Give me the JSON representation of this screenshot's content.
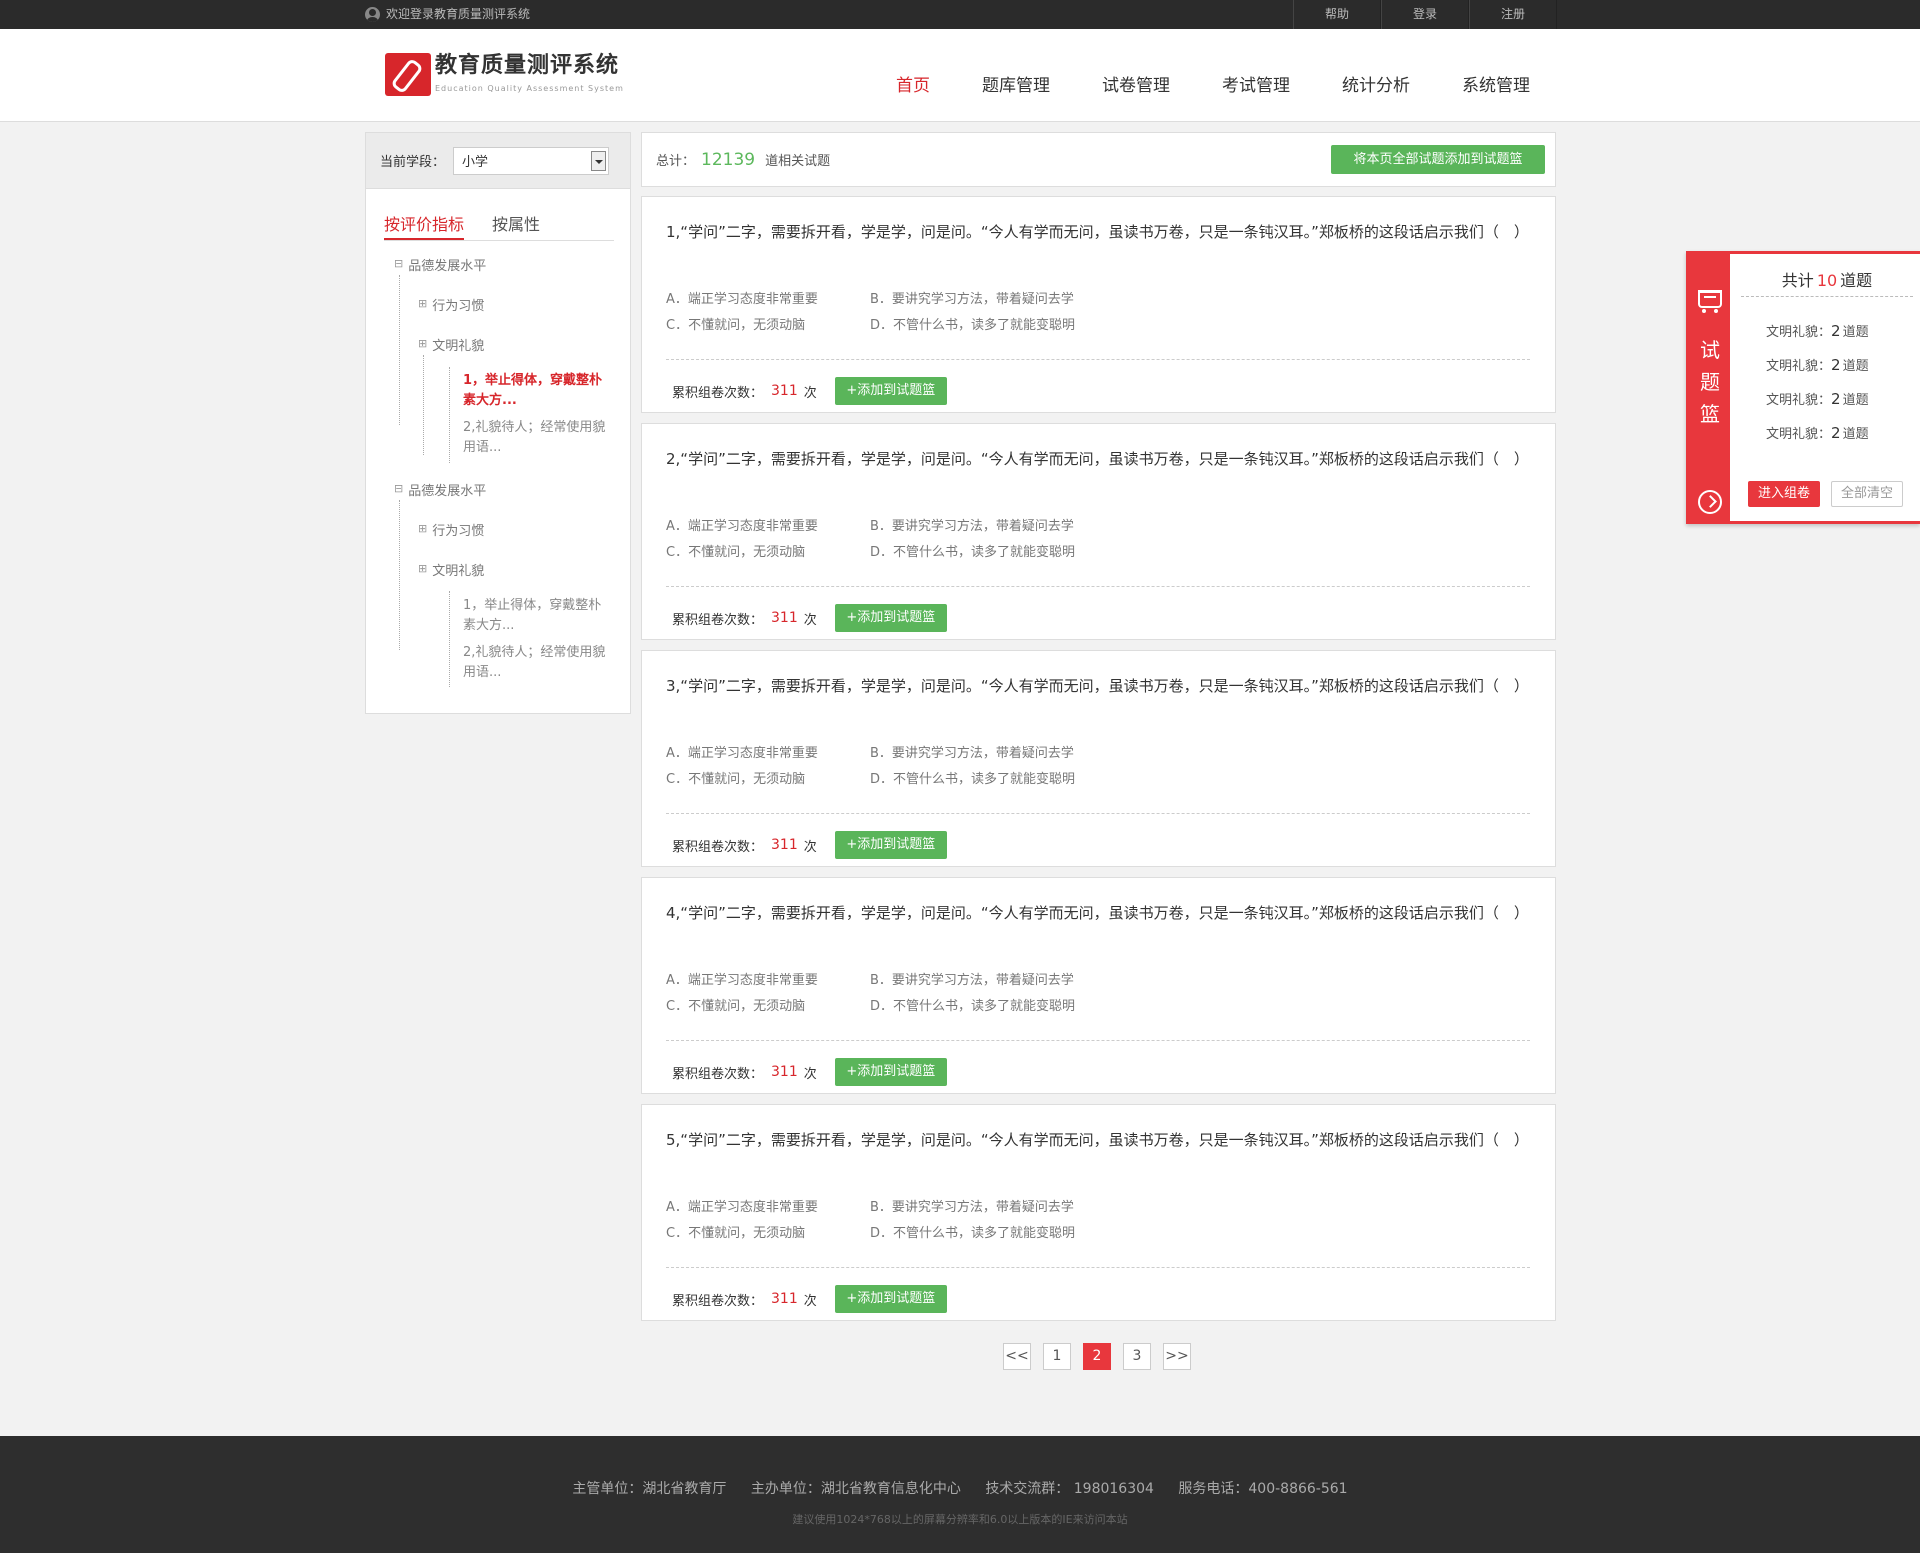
{
  "topbar": {
    "welcome": "欢迎登录教育质量测评系统",
    "links": [
      "帮助",
      "登录",
      "注册"
    ]
  },
  "header": {
    "logo_title": "教育质量测评系统",
    "logo_sub": "Education Quality Assessment System",
    "nav": [
      "首页",
      "题库管理",
      "试卷管理",
      "考试管理",
      "统计分析",
      "系统管理"
    ],
    "active_nav": 0
  },
  "sidebar": {
    "stage_label": "当前学段：",
    "stage_value": "小学",
    "tabs": [
      "按评价指标",
      "按属性"
    ],
    "groups": [
      {
        "title": "品德发展水平",
        "children": [
          "行为习惯",
          "文明礼貌"
        ],
        "leaves": [
          "1，举止得体，穿戴整朴素大方...",
          "2,礼貌待人；经常使用貌用语..."
        ]
      },
      {
        "title": "品德发展水平",
        "children": [
          "行为习惯",
          "文明礼貌"
        ],
        "leaves": [
          "1，举止得体，穿戴整朴素大方...",
          "2,礼貌待人；经常使用貌用语..."
        ]
      }
    ]
  },
  "summary": {
    "prefix": "总计：",
    "count": "12139",
    "suffix": "道相关试题",
    "add_all": "将本页全部试题添加到试题篮"
  },
  "questions": [
    {
      "stem": "1,“学问”二字，需要拆开看，学是学，问是问。“今人有学而无问，虽读书万卷，只是一条钝汉耳。”郑板桥的这段话启示我们（　）",
      "a": "A．端正学习态度非常重要",
      "b": "B．要讲究学习方法，带着疑问去学",
      "c": "C．不懂就问，无须动脑",
      "d": "D．不管什么书，读多了就能变聪明",
      "times_label": "累积组卷次数：",
      "times": "311",
      "times_unit": "次",
      "add": "+添加到试题篮"
    },
    {
      "stem": "2,“学问”二字，需要拆开看，学是学，问是问。“今人有学而无问，虽读书万卷，只是一条钝汉耳。”郑板桥的这段话启示我们（　）",
      "a": "A．端正学习态度非常重要",
      "b": "B．要讲究学习方法，带着疑问去学",
      "c": "C．不懂就问，无须动脑",
      "d": "D．不管什么书，读多了就能变聪明",
      "times_label": "累积组卷次数：",
      "times": "311",
      "times_unit": "次",
      "add": "+添加到试题篮"
    },
    {
      "stem": "3,“学问”二字，需要拆开看，学是学，问是问。“今人有学而无问，虽读书万卷，只是一条钝汉耳。”郑板桥的这段话启示我们（　）",
      "a": "A．端正学习态度非常重要",
      "b": "B．要讲究学习方法，带着疑问去学",
      "c": "C．不懂就问，无须动脑",
      "d": "D．不管什么书，读多了就能变聪明",
      "times_label": "累积组卷次数：",
      "times": "311",
      "times_unit": "次",
      "add": "+添加到试题篮"
    },
    {
      "stem": "4,“学问”二字，需要拆开看，学是学，问是问。“今人有学而无问，虽读书万卷，只是一条钝汉耳。”郑板桥的这段话启示我们（　）",
      "a": "A．端正学习态度非常重要",
      "b": "B．要讲究学习方法，带着疑问去学",
      "c": "C．不懂就问，无须动脑",
      "d": "D．不管什么书，读多了就能变聪明",
      "times_label": "累积组卷次数：",
      "times": "311",
      "times_unit": "次",
      "add": "+添加到试题篮"
    },
    {
      "stem": "5,“学问”二字，需要拆开看，学是学，问是问。“今人有学而无问，虽读书万卷，只是一条钝汉耳。”郑板桥的这段话启示我们（　）",
      "a": "A．端正学习态度非常重要",
      "b": "B．要讲究学习方法，带着疑问去学",
      "c": "C．不懂就问，无须动脑",
      "d": "D．不管什么书，读多了就能变聪明",
      "times_label": "累积组卷次数：",
      "times": "311",
      "times_unit": "次",
      "add": "+添加到试题篮"
    }
  ],
  "pager": {
    "prev": "<<",
    "pages": [
      "1",
      "2",
      "3"
    ],
    "current": "2",
    "next": ">>"
  },
  "basket": {
    "side_text": [
      "试",
      "题",
      "篮"
    ],
    "title_prefix": "共计",
    "title_count": "10",
    "title_suffix": "道题",
    "items": [
      {
        "name": "文明礼貌：",
        "count": "2",
        "unit": "道题"
      },
      {
        "name": "文明礼貌：",
        "count": "2",
        "unit": "道题"
      },
      {
        "name": "文明礼貌：",
        "count": "2",
        "unit": "道题"
      },
      {
        "name": "文明礼貌：",
        "count": "2",
        "unit": "道题"
      }
    ],
    "enter": "进入组卷",
    "clear": "全部清空"
  },
  "footer": {
    "items": [
      "主管单位：湖北省教育厅",
      "主办单位：湖北省教育信息化中心",
      "技术交流群：  198016304",
      "服务电话：400-8866-561"
    ],
    "note": "建议使用1024*768以上的屏幕分辨率和6.0以上版本的IE来访问本站"
  },
  "colors": {
    "accent_red": "#e8373d",
    "accent_green": "#5ab55a",
    "topbar_bg": "#2b2b2b",
    "footer_bg": "#2e2e2e"
  }
}
